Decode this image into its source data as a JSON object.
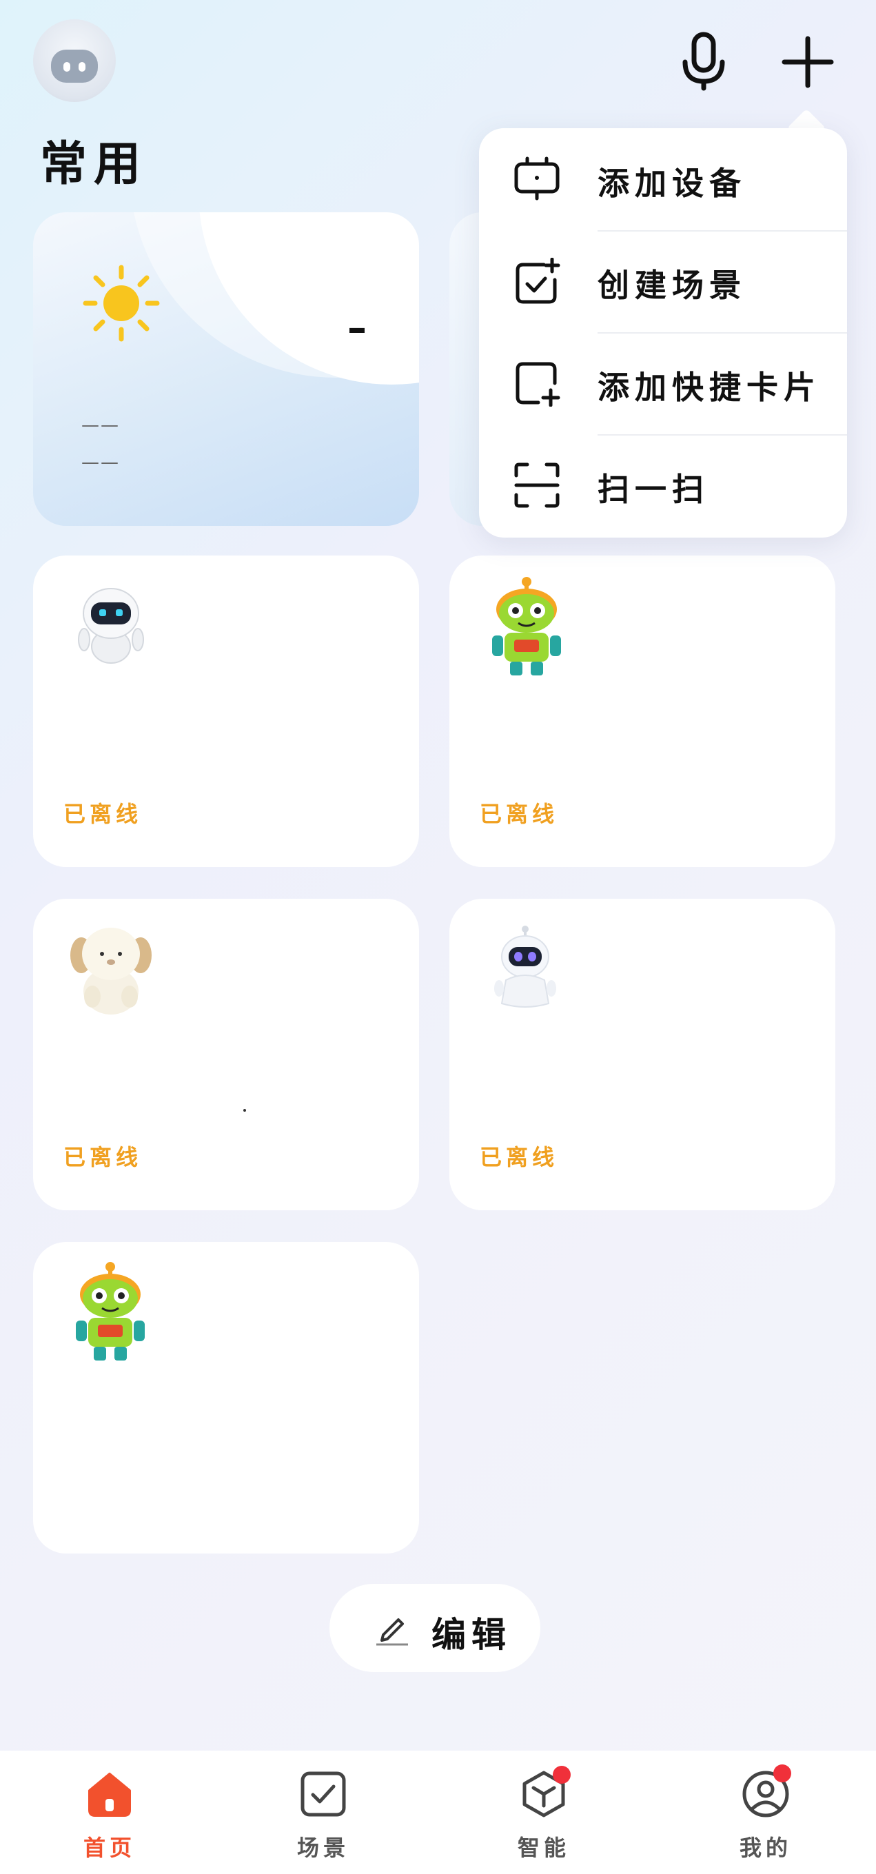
{
  "header": {
    "title": "常用"
  },
  "weather": {
    "temperature": "–",
    "line1": "——",
    "line2": "——"
  },
  "devices": [
    {
      "status": "已离线",
      "icon": "white-robot-icon"
    },
    {
      "status": "已离线",
      "icon": "green-robot-icon"
    },
    {
      "status": "已离线",
      "icon": "plush-sheep-icon"
    },
    {
      "status": "已离线",
      "icon": "small-white-robot-icon"
    },
    {
      "status": "",
      "icon": "green-robot-icon"
    }
  ],
  "popup_menu": {
    "items": [
      {
        "label": "添加设备",
        "icon": "add-device-icon"
      },
      {
        "label": "创建场景",
        "icon": "create-scene-icon"
      },
      {
        "label": "添加快捷卡片",
        "icon": "add-card-icon"
      },
      {
        "label": "扫一扫",
        "icon": "scan-icon"
      }
    ]
  },
  "edit_button": {
    "label": "编辑"
  },
  "tabbar": {
    "tabs": [
      {
        "label": "首页",
        "active": true
      },
      {
        "label": "场景",
        "active": false
      },
      {
        "label": "智能",
        "active": false,
        "badge": true
      },
      {
        "label": "我的",
        "active": false,
        "badge": true
      }
    ]
  },
  "colors": {
    "accent": "#f2512d",
    "offline": "#f0a020",
    "badge": "#f0303a",
    "inactive_tab": "#555555"
  }
}
